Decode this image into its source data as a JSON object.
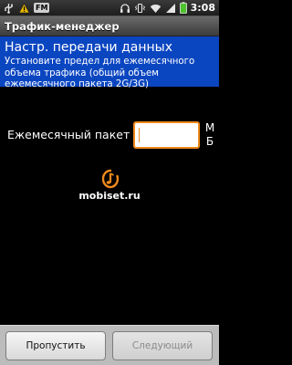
{
  "status_bar": {
    "time": "3:08",
    "fm_label": "FM",
    "icons": [
      "usb-icon",
      "warning-icon",
      "fm-radio-icon",
      "headphones-icon",
      "vibrate-icon",
      "wifi-icon",
      "signal-icon",
      "battery-icon"
    ]
  },
  "app": {
    "title": "Трафик-менеджер"
  },
  "header": {
    "title": "Настр. передачи данных",
    "description": "Установите предел для ежемесячного объема трафика (общий объем ежемесячного пакета 2G/3G)"
  },
  "form": {
    "monthly_label": "Ежемесячный пакет",
    "monthly_value": "",
    "unit_line1": "М",
    "unit_line2": "Б"
  },
  "watermark": {
    "text": "mobiset.ru"
  },
  "buttons": {
    "skip_label": "Пропустить",
    "next_label": "Следующий"
  },
  "colors": {
    "header_bg": "#0b46c1",
    "input_focus_border": "#f08a1c",
    "watermark_logo": "#f08a1c"
  }
}
